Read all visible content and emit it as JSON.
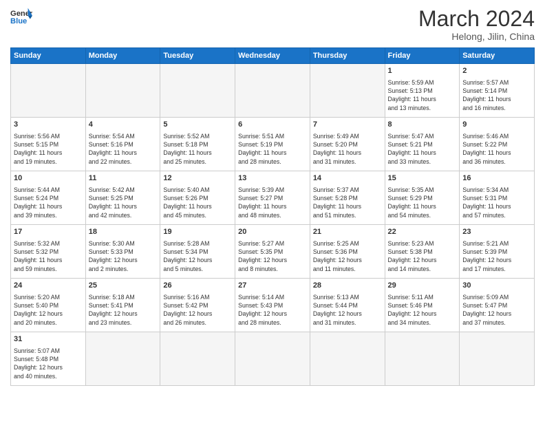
{
  "logo": {
    "text_general": "General",
    "text_blue": "Blue"
  },
  "header": {
    "month": "March 2024",
    "location": "Helong, Jilin, China"
  },
  "weekdays": [
    "Sunday",
    "Monday",
    "Tuesday",
    "Wednesday",
    "Thursday",
    "Friday",
    "Saturday"
  ],
  "weeks": [
    [
      {
        "day": "",
        "info": ""
      },
      {
        "day": "",
        "info": ""
      },
      {
        "day": "",
        "info": ""
      },
      {
        "day": "",
        "info": ""
      },
      {
        "day": "",
        "info": ""
      },
      {
        "day": "1",
        "info": "Sunrise: 5:59 AM\nSunset: 5:13 PM\nDaylight: 11 hours\nand 13 minutes."
      },
      {
        "day": "2",
        "info": "Sunrise: 5:57 AM\nSunset: 5:14 PM\nDaylight: 11 hours\nand 16 minutes."
      }
    ],
    [
      {
        "day": "3",
        "info": "Sunrise: 5:56 AM\nSunset: 5:15 PM\nDaylight: 11 hours\nand 19 minutes."
      },
      {
        "day": "4",
        "info": "Sunrise: 5:54 AM\nSunset: 5:16 PM\nDaylight: 11 hours\nand 22 minutes."
      },
      {
        "day": "5",
        "info": "Sunrise: 5:52 AM\nSunset: 5:18 PM\nDaylight: 11 hours\nand 25 minutes."
      },
      {
        "day": "6",
        "info": "Sunrise: 5:51 AM\nSunset: 5:19 PM\nDaylight: 11 hours\nand 28 minutes."
      },
      {
        "day": "7",
        "info": "Sunrise: 5:49 AM\nSunset: 5:20 PM\nDaylight: 11 hours\nand 31 minutes."
      },
      {
        "day": "8",
        "info": "Sunrise: 5:47 AM\nSunset: 5:21 PM\nDaylight: 11 hours\nand 33 minutes."
      },
      {
        "day": "9",
        "info": "Sunrise: 5:46 AM\nSunset: 5:22 PM\nDaylight: 11 hours\nand 36 minutes."
      }
    ],
    [
      {
        "day": "10",
        "info": "Sunrise: 5:44 AM\nSunset: 5:24 PM\nDaylight: 11 hours\nand 39 minutes."
      },
      {
        "day": "11",
        "info": "Sunrise: 5:42 AM\nSunset: 5:25 PM\nDaylight: 11 hours\nand 42 minutes."
      },
      {
        "day": "12",
        "info": "Sunrise: 5:40 AM\nSunset: 5:26 PM\nDaylight: 11 hours\nand 45 minutes."
      },
      {
        "day": "13",
        "info": "Sunrise: 5:39 AM\nSunset: 5:27 PM\nDaylight: 11 hours\nand 48 minutes."
      },
      {
        "day": "14",
        "info": "Sunrise: 5:37 AM\nSunset: 5:28 PM\nDaylight: 11 hours\nand 51 minutes."
      },
      {
        "day": "15",
        "info": "Sunrise: 5:35 AM\nSunset: 5:29 PM\nDaylight: 11 hours\nand 54 minutes."
      },
      {
        "day": "16",
        "info": "Sunrise: 5:34 AM\nSunset: 5:31 PM\nDaylight: 11 hours\nand 57 minutes."
      }
    ],
    [
      {
        "day": "17",
        "info": "Sunrise: 5:32 AM\nSunset: 5:32 PM\nDaylight: 11 hours\nand 59 minutes."
      },
      {
        "day": "18",
        "info": "Sunrise: 5:30 AM\nSunset: 5:33 PM\nDaylight: 12 hours\nand 2 minutes."
      },
      {
        "day": "19",
        "info": "Sunrise: 5:28 AM\nSunset: 5:34 PM\nDaylight: 12 hours\nand 5 minutes."
      },
      {
        "day": "20",
        "info": "Sunrise: 5:27 AM\nSunset: 5:35 PM\nDaylight: 12 hours\nand 8 minutes."
      },
      {
        "day": "21",
        "info": "Sunrise: 5:25 AM\nSunset: 5:36 PM\nDaylight: 12 hours\nand 11 minutes."
      },
      {
        "day": "22",
        "info": "Sunrise: 5:23 AM\nSunset: 5:38 PM\nDaylight: 12 hours\nand 14 minutes."
      },
      {
        "day": "23",
        "info": "Sunrise: 5:21 AM\nSunset: 5:39 PM\nDaylight: 12 hours\nand 17 minutes."
      }
    ],
    [
      {
        "day": "24",
        "info": "Sunrise: 5:20 AM\nSunset: 5:40 PM\nDaylight: 12 hours\nand 20 minutes."
      },
      {
        "day": "25",
        "info": "Sunrise: 5:18 AM\nSunset: 5:41 PM\nDaylight: 12 hours\nand 23 minutes."
      },
      {
        "day": "26",
        "info": "Sunrise: 5:16 AM\nSunset: 5:42 PM\nDaylight: 12 hours\nand 26 minutes."
      },
      {
        "day": "27",
        "info": "Sunrise: 5:14 AM\nSunset: 5:43 PM\nDaylight: 12 hours\nand 28 minutes."
      },
      {
        "day": "28",
        "info": "Sunrise: 5:13 AM\nSunset: 5:44 PM\nDaylight: 12 hours\nand 31 minutes."
      },
      {
        "day": "29",
        "info": "Sunrise: 5:11 AM\nSunset: 5:46 PM\nDaylight: 12 hours\nand 34 minutes."
      },
      {
        "day": "30",
        "info": "Sunrise: 5:09 AM\nSunset: 5:47 PM\nDaylight: 12 hours\nand 37 minutes."
      }
    ],
    [
      {
        "day": "31",
        "info": "Sunrise: 5:07 AM\nSunset: 5:48 PM\nDaylight: 12 hours\nand 40 minutes."
      },
      {
        "day": "",
        "info": ""
      },
      {
        "day": "",
        "info": ""
      },
      {
        "day": "",
        "info": ""
      },
      {
        "day": "",
        "info": ""
      },
      {
        "day": "",
        "info": ""
      },
      {
        "day": "",
        "info": ""
      }
    ]
  ]
}
